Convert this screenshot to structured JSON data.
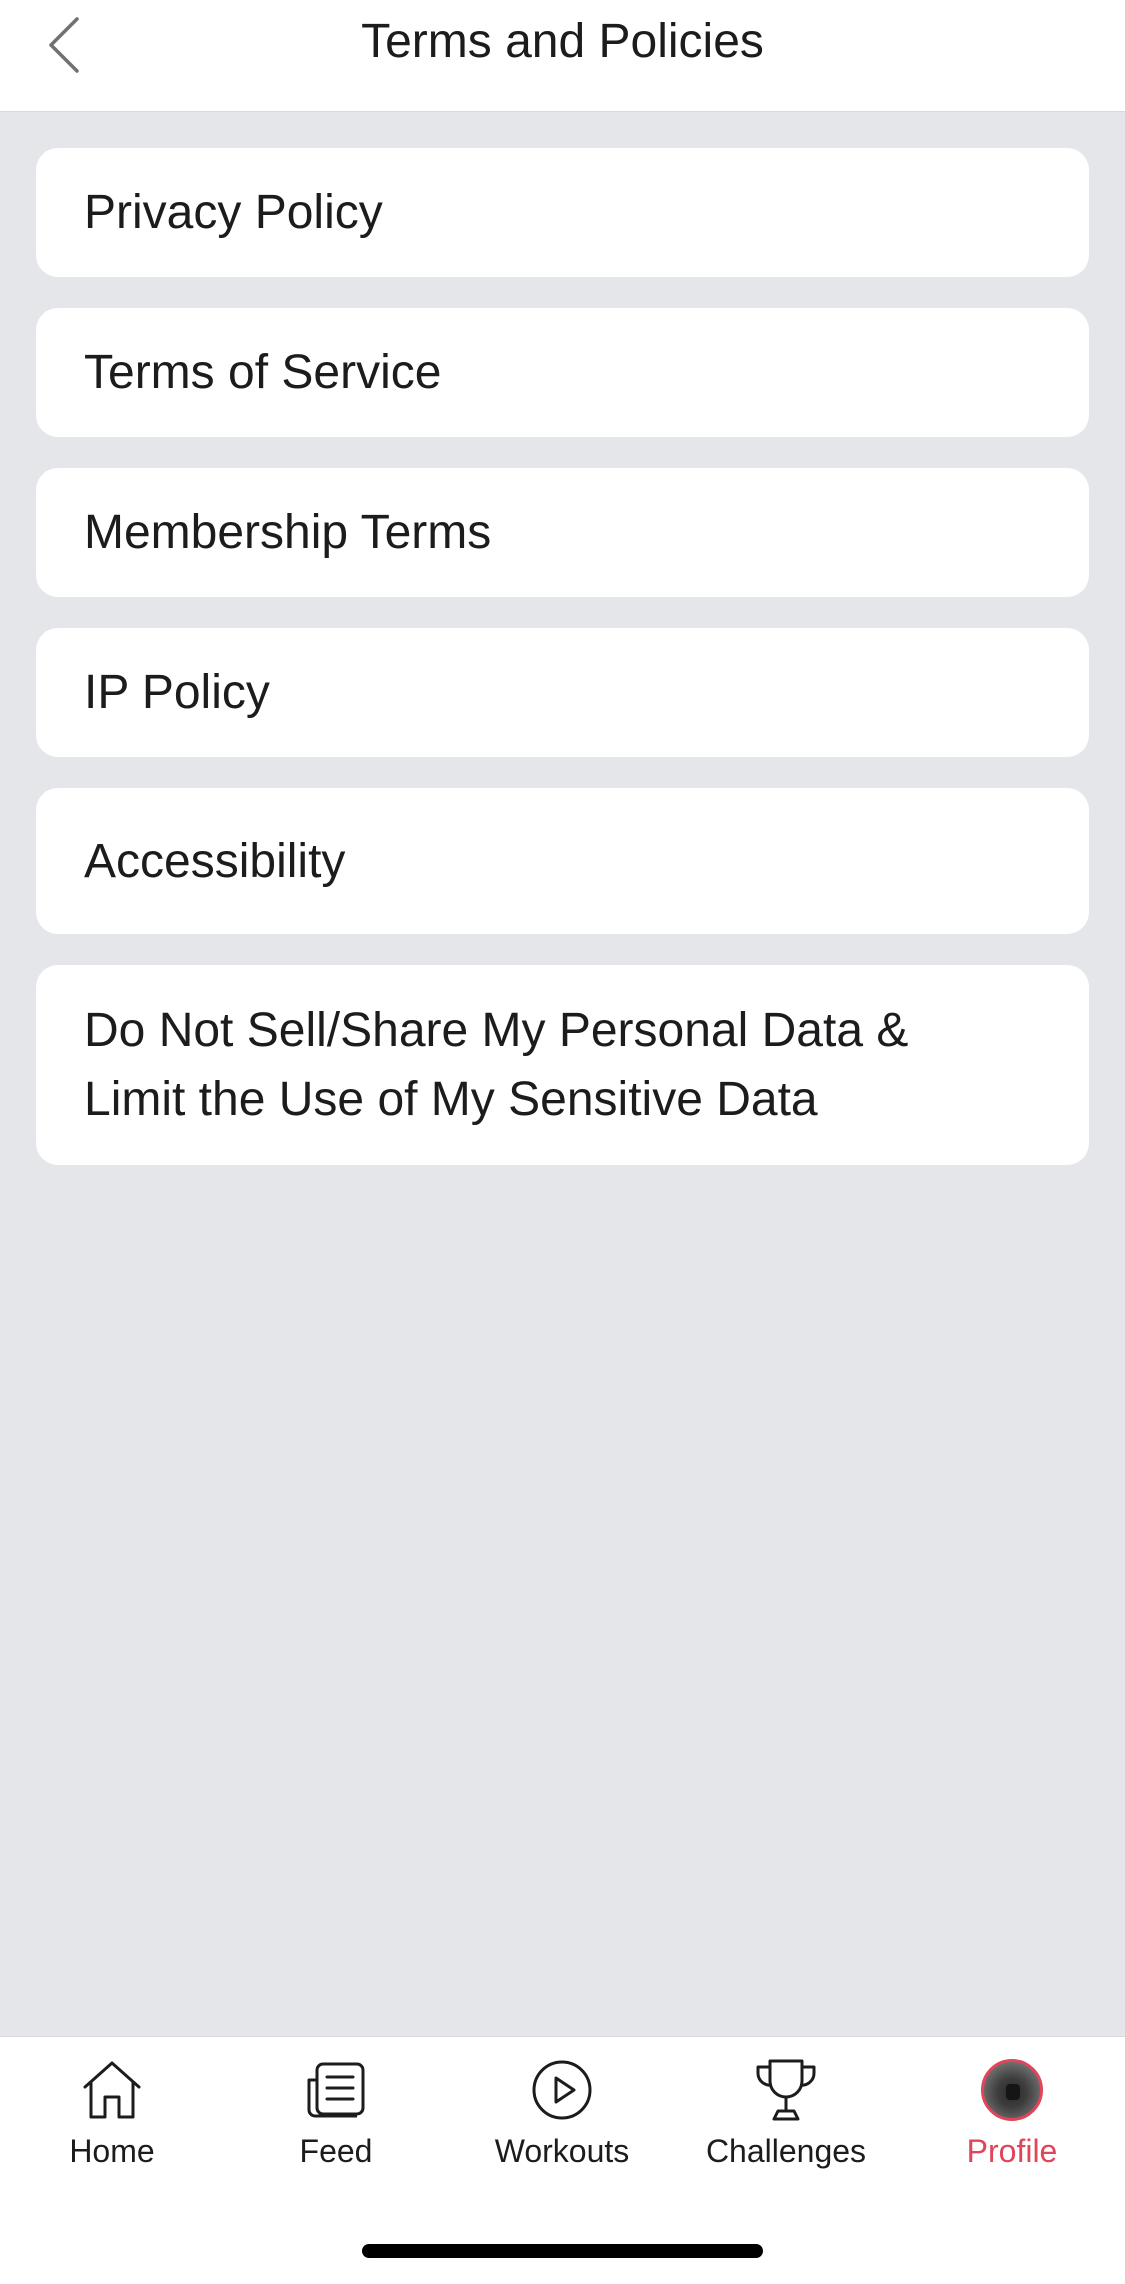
{
  "header": {
    "title": "Terms and Policies",
    "back_icon": "chevron-left-icon"
  },
  "policies": [
    {
      "label": "Privacy Policy"
    },
    {
      "label": "Terms of Service"
    },
    {
      "label": "Membership Terms"
    },
    {
      "label": "IP Policy"
    },
    {
      "label": "Accessibility"
    },
    {
      "label": "Do Not Sell/Share My Personal Data & Limit the Use of My Sensitive Data"
    }
  ],
  "tabbar": {
    "active_color": "#E0455A",
    "tabs": [
      {
        "label": "Home",
        "icon": "home-icon"
      },
      {
        "label": "Feed",
        "icon": "feed-icon"
      },
      {
        "label": "Workouts",
        "icon": "play-circle-icon"
      },
      {
        "label": "Challenges",
        "icon": "trophy-icon"
      },
      {
        "label": "Profile",
        "icon": "avatar",
        "active": true
      }
    ]
  }
}
